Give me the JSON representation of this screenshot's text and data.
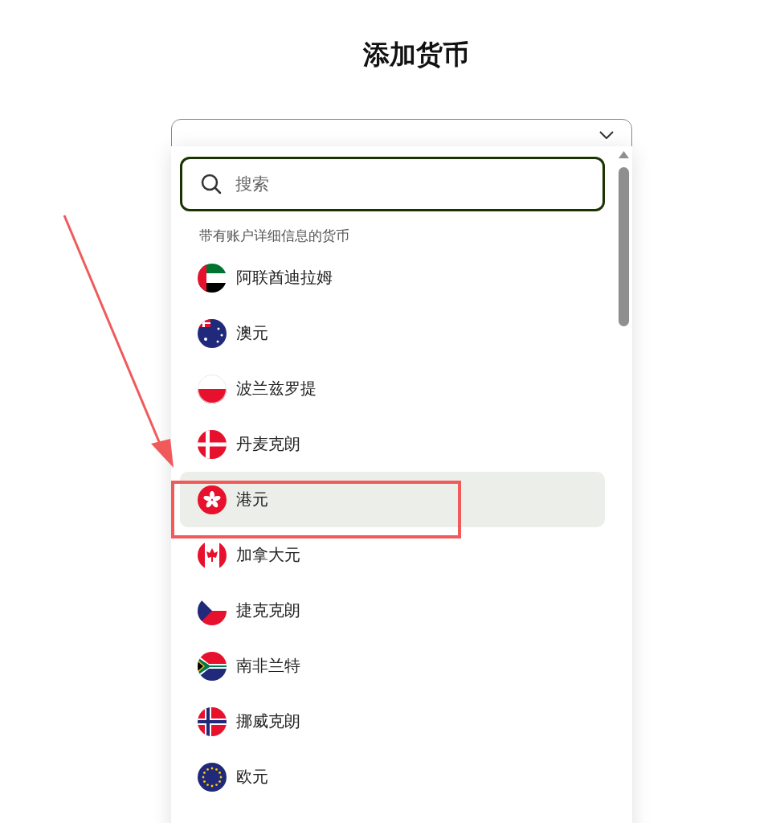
{
  "title": "添加货币",
  "dropdown": {
    "search": {
      "placeholder": "搜索"
    },
    "section": "带有账户详细信息的货币",
    "items": [
      {
        "label": "阿联酋迪拉姆",
        "selected": false
      },
      {
        "label": "澳元",
        "selected": false
      },
      {
        "label": "波兰兹罗提",
        "selected": false
      },
      {
        "label": "丹麦克朗",
        "selected": false
      },
      {
        "label": "港元",
        "selected": true
      },
      {
        "label": "加拿大元",
        "selected": false
      },
      {
        "label": "捷克克朗",
        "selected": false
      },
      {
        "label": "南非兰特",
        "selected": false
      },
      {
        "label": "挪威克朗",
        "selected": false
      },
      {
        "label": "欧元",
        "selected": false
      }
    ]
  }
}
